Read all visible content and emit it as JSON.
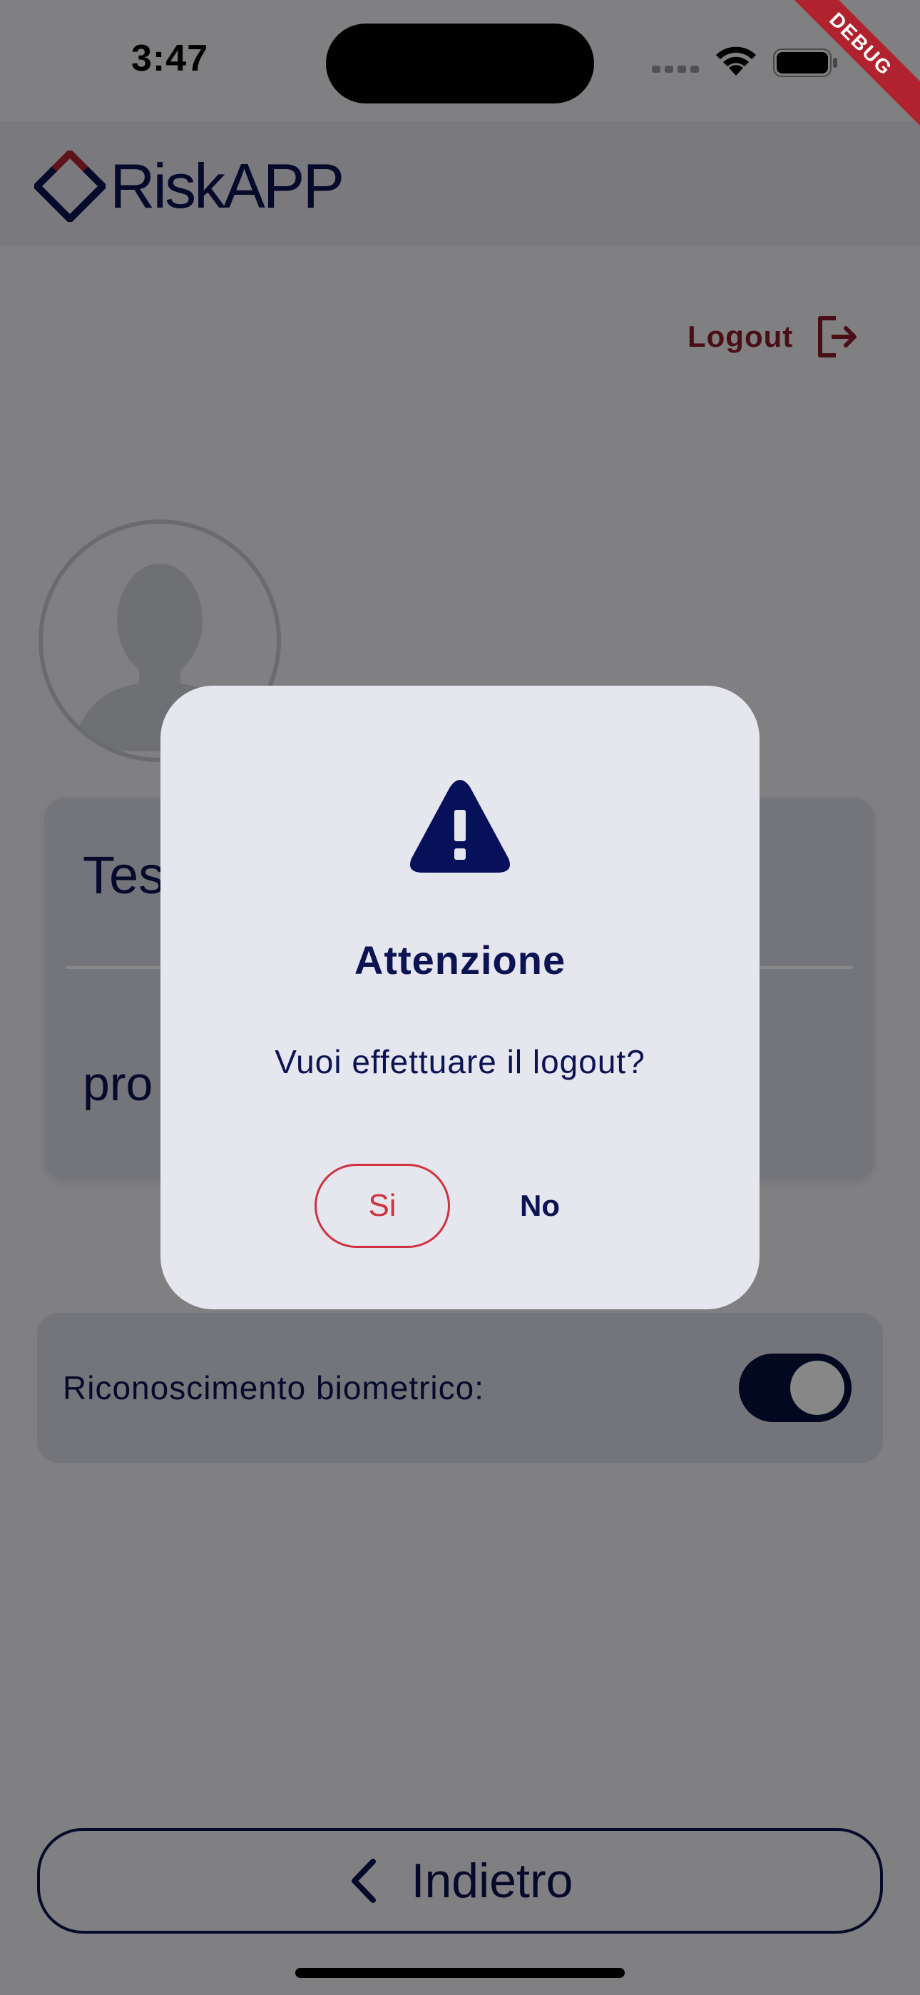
{
  "status_bar": {
    "time": "3:47",
    "debug_label": "DEBUG"
  },
  "app_bar": {
    "logo_text": "RiskAPP",
    "logo_icon": "diamond-logo-icon"
  },
  "profile": {
    "logout_label": "Logout",
    "logout_icon": "logout-icon",
    "name_visible": "Tes",
    "role_visible": "pro"
  },
  "settings": {
    "biometric_label": "Riconoscimento biometrico:",
    "biometric_enabled": true
  },
  "navigation": {
    "back_label": "Indietro",
    "back_icon": "chevron-left-icon"
  },
  "dialog": {
    "icon": "warning-icon",
    "title": "Attenzione",
    "message": "Vuoi effettuare il logout?",
    "yes_label": "Si",
    "no_label": "No"
  },
  "colors": {
    "primary": "#0b1352",
    "accent_red": "#d0323e",
    "logout_red": "#8c1d2b",
    "background": "#f1f1f6",
    "card": "#dcdde7",
    "dialog": "#e6e6ef"
  }
}
